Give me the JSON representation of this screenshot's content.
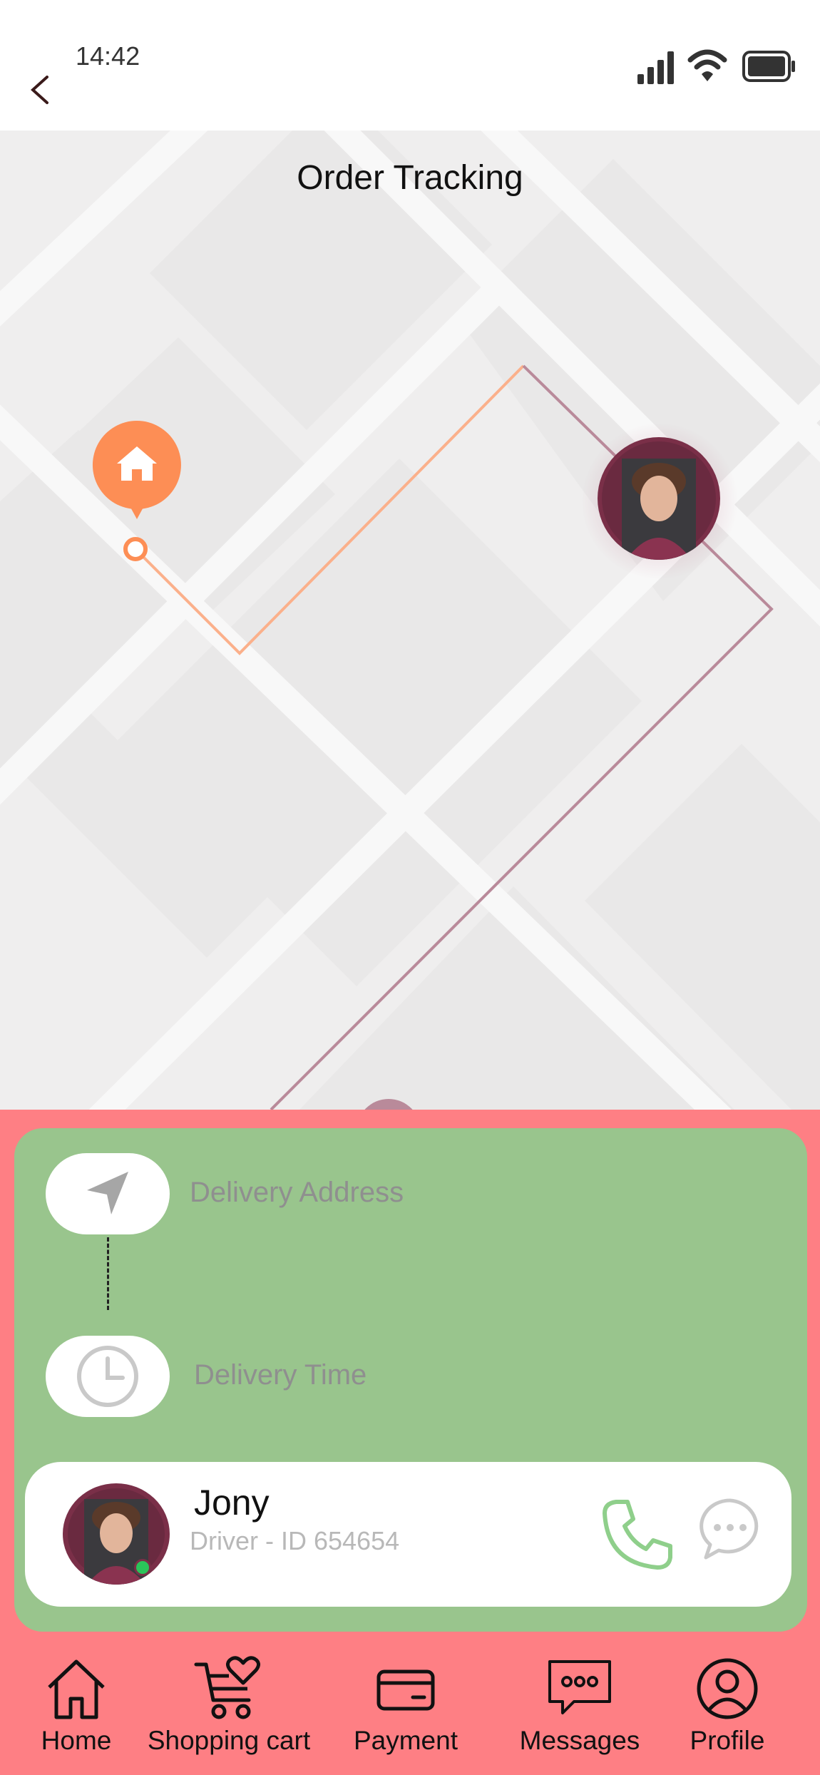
{
  "status_bar": {
    "time": "14:42",
    "icons": [
      "signal-icon",
      "wifi-icon",
      "battery-icon"
    ]
  },
  "header": {
    "back_icon": "chevron-left-icon",
    "title": "Order Tracking"
  },
  "map": {
    "destination_marker_icon": "home-icon",
    "route_colors": {
      "completed": "#fbb08b",
      "remaining": "#b98a9a"
    },
    "marker_color": "#fd8e55"
  },
  "delivery": {
    "address_label": "Delivery Address",
    "address_icon": "navigation-arrow-icon",
    "time_label": "Delivery Time",
    "time_icon": "clock-icon"
  },
  "driver": {
    "name": "Jony",
    "id_text": "Driver - ID 654654",
    "status": "online",
    "call_icon": "phone-icon",
    "message_icon": "chat-bubble-icon"
  },
  "nav": {
    "items": [
      {
        "label": "Home",
        "icon": "home-icon"
      },
      {
        "label": "Shopping cart",
        "icon": "cart-heart-icon"
      },
      {
        "label": "Payment",
        "icon": "card-icon"
      },
      {
        "label": "Messages",
        "icon": "message-dots-icon"
      },
      {
        "label": "Profile",
        "icon": "user-circle-icon"
      }
    ]
  },
  "colors": {
    "panel": "#fe7f84",
    "card": "#99c58d",
    "call_green": "#8fcf8b",
    "driver_avatar": "#7a2f48"
  }
}
